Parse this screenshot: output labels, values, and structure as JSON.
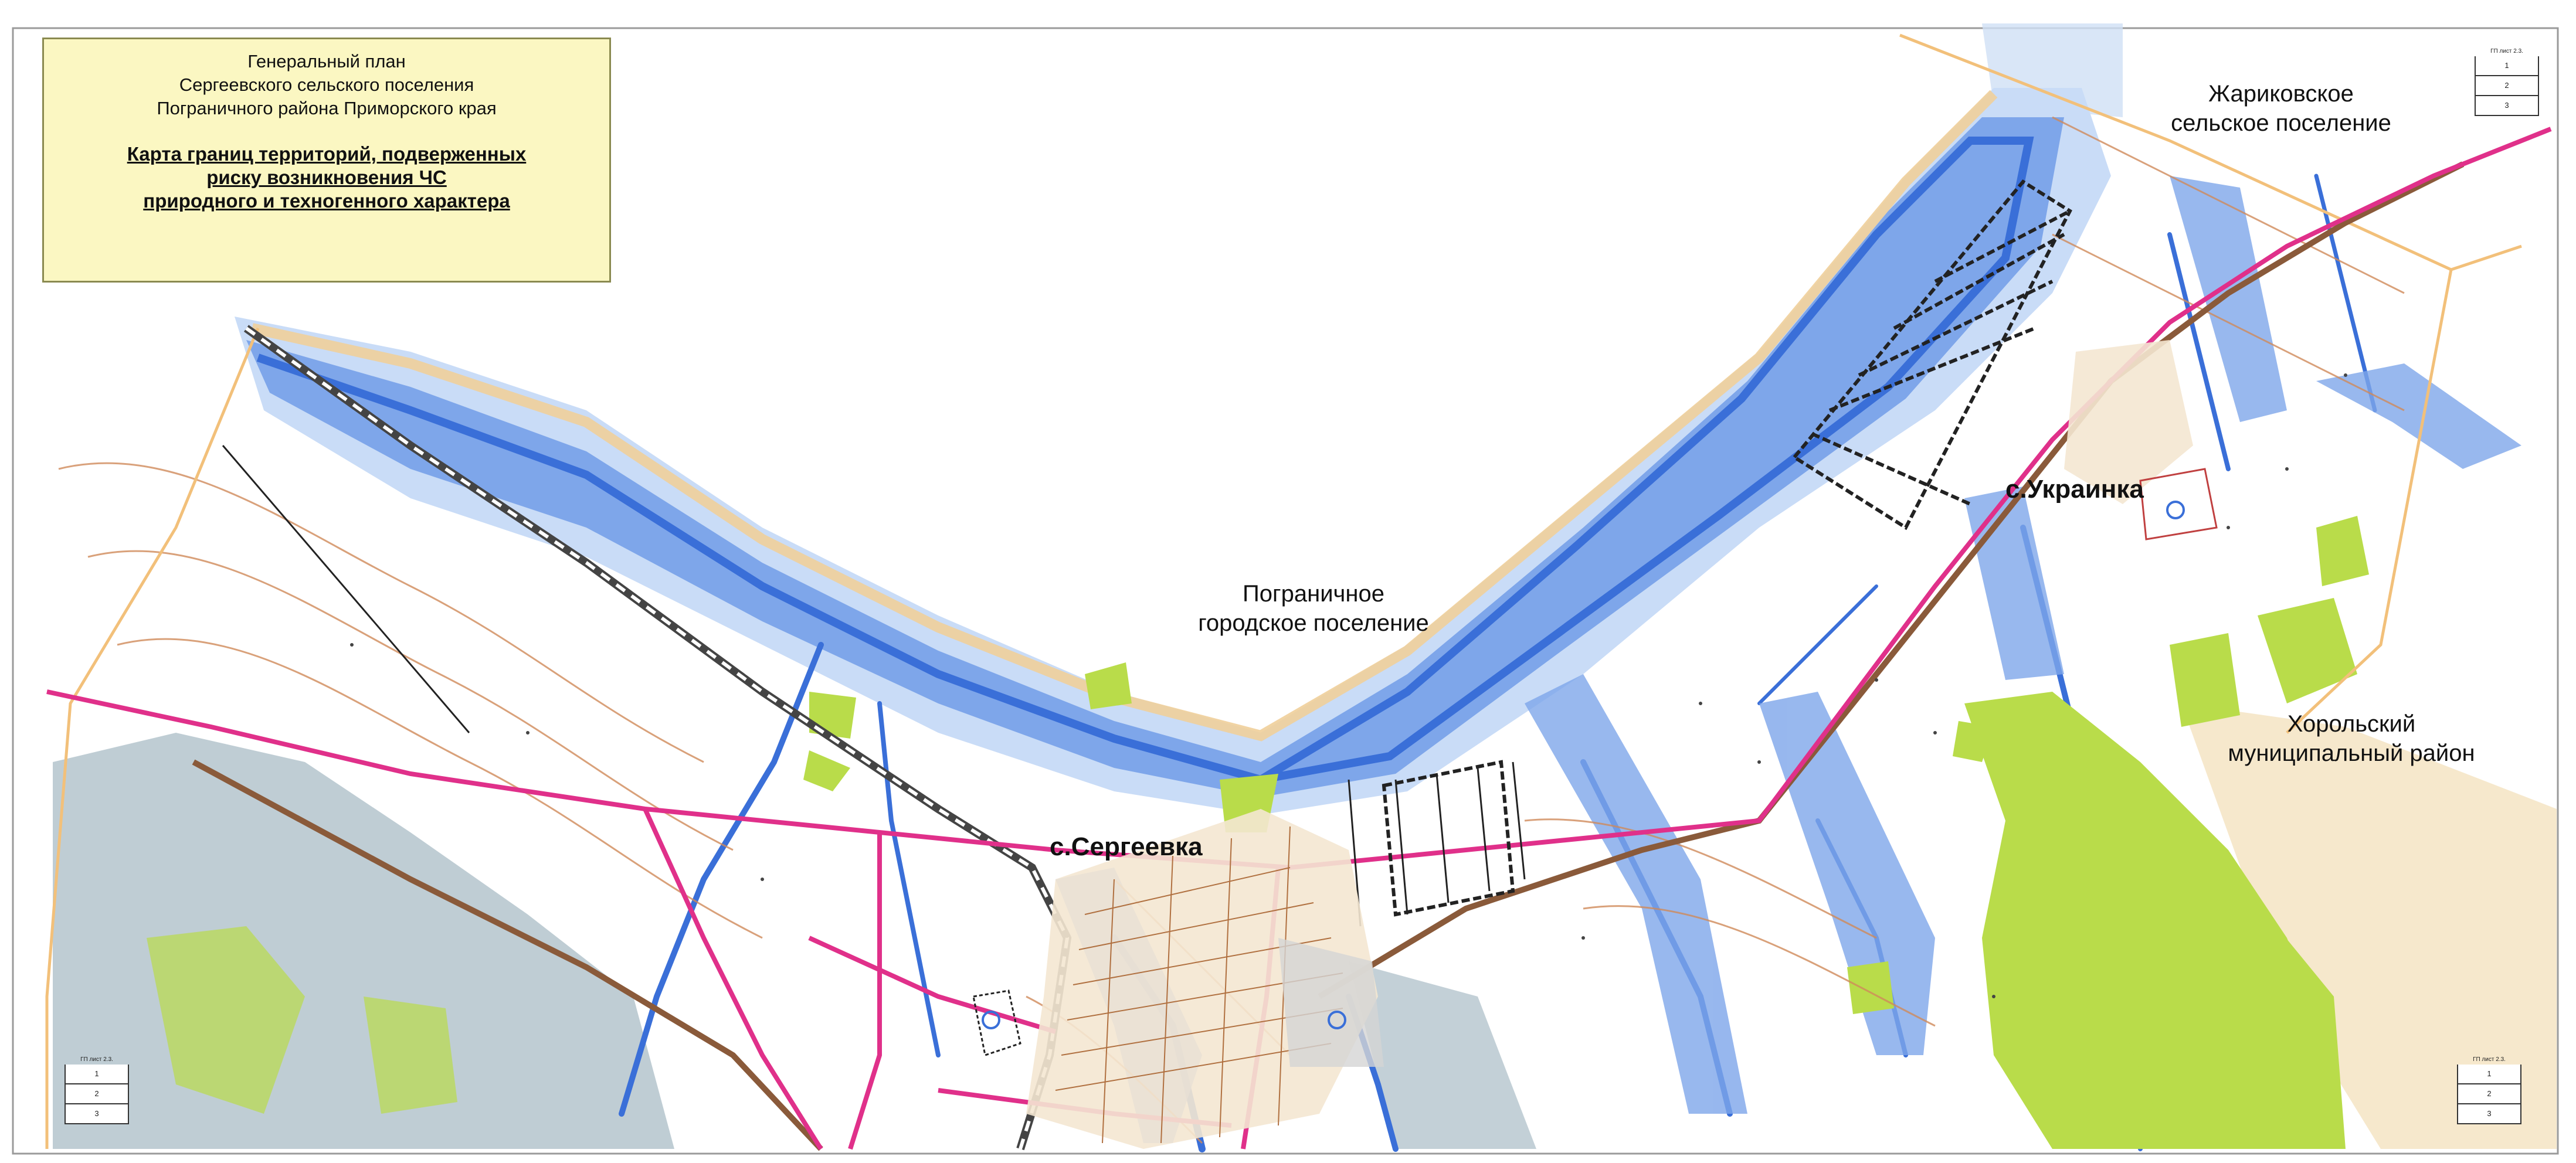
{
  "title": {
    "line1": "Генеральный план",
    "line2": "Сергеевского сельского поселения",
    "line3": "Пограничного района Приморского края",
    "sub1": "Карта границ территорий, подверженных",
    "sub2": "риску возникновения ЧС",
    "sub3": "природного и техногенного характера"
  },
  "places": {
    "zharikovskoe_1": "Жариковское",
    "zharikovskoe_2": "сельское поселение",
    "pogranichnoe_1": "Пограничное",
    "pogranichnoe_2": "городское поселение",
    "khorolsky_1": "Хорольский",
    "khorolsky_2": "муниципальный район",
    "sergeevka": "с.Сергеевка",
    "ukrainka": "с.Украинка"
  },
  "sheet_tables": {
    "caption": "ГП лист 2.3.",
    "rows": [
      "1",
      "2",
      "3"
    ]
  },
  "colors": {
    "water": "#3a6fd8",
    "water_light": "#a9c6f2",
    "flood_zone": "#c9dcf7",
    "forest": "#b9dc4a",
    "gray_zone": "#9fb1bd",
    "road_pink": "#e0308a",
    "railway": "#555555",
    "highway": "#8a5a3a",
    "contour": "#d08a5a",
    "boundary": "#f2c07a",
    "title_bg": "#fbf7c2"
  }
}
